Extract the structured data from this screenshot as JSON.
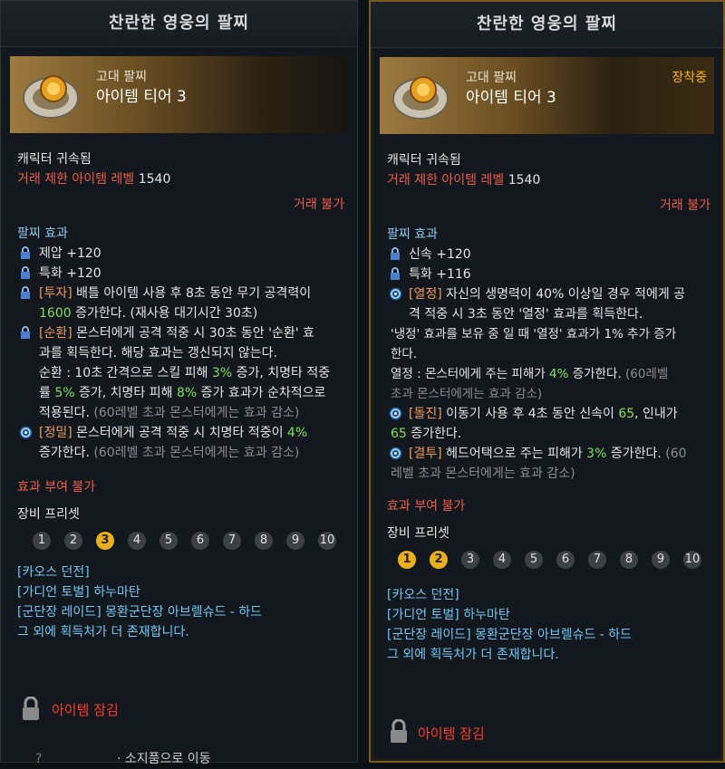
{
  "left": {
    "title": "찬란한 영웅의 팔찌",
    "grade": "고대 팔찌",
    "tier": "아이템 티어 3",
    "bound": "캐릭터 귀속됨",
    "trade_limit_label": "거래 제한 아이템 레벨",
    "trade_limit_value": "1540",
    "no_trade": "거래 불가",
    "effects_header": "팔찌 효과",
    "stat1": "제압 +120",
    "stat2": "특화 +120",
    "e1_tag": "[투자]",
    "e1_a": " 배틀 아이템 사용 후 8초 동안 무기 공격력이",
    "e1_num": "1600",
    "e1_b": " 증가한다. (재사용 대기시간 30초)",
    "e2_tag": "[순환]",
    "e2_a": " 몬스터에게 공격 적중 시 30초 동안 '순환' 효",
    "e2_b": "과를 획득한다. 해당 효과는 갱신되지 않는다.",
    "e2_c1": "순환 : 10초 간격으로 스킬 피해 ",
    "e2_n1": "3%",
    "e2_c2": " 증가, 치명타 적중",
    "e2_d1": "률 ",
    "e2_n2": "5%",
    "e2_d2": " 증가, 치명타 피해 ",
    "e2_n3": "8%",
    "e2_d3": " 증가 효과가 순차적으로",
    "e2_e1": "적용된다.",
    "e2_note": " (60레벨 초과 몬스터에게는 효과 감소)",
    "e3_tag": "[정밀]",
    "e3_a": " 몬스터에게 공격 적중 시 치명타 적중이 ",
    "e3_num": "4%",
    "e3_b": "증가한다.",
    "e3_note": " (60레벨 초과 몬스터에게는 효과 감소)",
    "no_grant": "효과 부여 불가",
    "preset_label": "장비 프리셋",
    "presets": [
      "1",
      "2",
      "3",
      "4",
      "5",
      "6",
      "7",
      "8",
      "9",
      "10"
    ],
    "src1": "[카오스 던전]",
    "src2": "[가디언 토벌] 하누마탄",
    "src3": "[군단장 레이드] 몽환군단장 아브렐슈드 - 하드",
    "src4": "그 외에 획득처가 더 존재합니다.",
    "locked": "아이템 잠김",
    "bottom_frag": "· 소지품으로 이동",
    "bottom_q": "?"
  },
  "right": {
    "title": "찬란한 영웅의 팔찌",
    "grade": "고대 팔찌",
    "tier": "아이템 티어 3",
    "equipped": "장착중",
    "bound": "캐릭터 귀속됨",
    "trade_limit_label": "거래 제한 아이템 레벨",
    "trade_limit_value": "1540",
    "no_trade": "거래 불가",
    "effects_header": "팔찌 효과",
    "stat1": "신속 +120",
    "stat2": "특화 +116",
    "e1_tag": "[열정]",
    "e1_a": " 자신의 생명력이 40% 이상일 경우 적에게 공",
    "e1_b": "격 적중 시 3초 동안 '열정' 효과를 획득한다.",
    "e1_c": "'냉정' 효과를 보유 중 일 때 '열정' 효과가 1% 추가 증가",
    "e1_d": "한다.",
    "e1_e1": "열정 : 몬스터에게 주는 피해가 ",
    "e1_num": "4%",
    "e1_e2": " 증가한다.",
    "e1_note1": " (60레벨",
    "e1_note2": "초과 몬스터에게는 효과 감소)",
    "e2_tag": "[돌진]",
    "e2_a": " 이동기 사용 후 4초 동안 신속이 ",
    "e2_n1": "65",
    "e2_b": ", 인내가",
    "e2_n2": "65",
    "e2_c": " 증가한다.",
    "e3_tag": "[결투]",
    "e3_a": " 헤드어택으로 주는 피해가 ",
    "e3_num": "3%",
    "e3_b": " 증가한다.",
    "e3_note1": " (60",
    "e3_note2": "레벨 초과 몬스터에게는 효과 감소)",
    "no_grant": "효과 부여 불가",
    "preset_label": "장비 프리셋",
    "presets": [
      "1",
      "2",
      "3",
      "4",
      "5",
      "6",
      "7",
      "8",
      "9",
      "10"
    ],
    "src1": "[카오스 던전]",
    "src2": "[가디언 토벌] 하누마탄",
    "src3": "[군단장 레이드] 몽환군단장 아브렐슈드 - 하드",
    "src4": "그 외에 획득처가 더 존재합니다.",
    "locked": "아이템 잠김"
  },
  "colors": {
    "tag": "#ef9a5a",
    "green": "#7ee05a",
    "red": "#ef5b4b",
    "link": "#72c6f2",
    "gold": "#e8b020"
  }
}
